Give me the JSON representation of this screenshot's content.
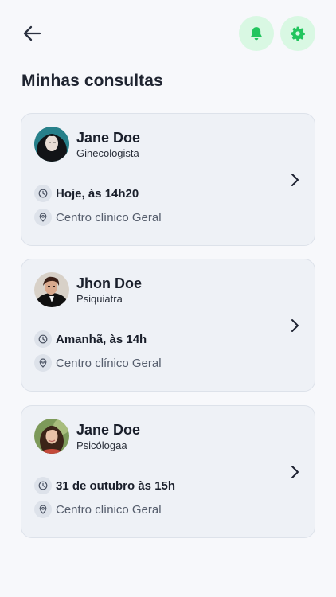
{
  "header": {
    "back_icon": "arrow-left-icon",
    "notifications_icon": "bell-icon",
    "settings_icon": "gear-icon",
    "accent_color": "#22c55e",
    "accent_bg": "#d9f8e3"
  },
  "page": {
    "title": "Minhas consultas"
  },
  "appointments": [
    {
      "doctor": "Jane Doe",
      "specialty": "Ginecologista",
      "when": "Hoje, às 14h20",
      "place": "Centro clínico Geral"
    },
    {
      "doctor": "Jhon Doe",
      "specialty": "Psiquiatra",
      "when": "Amanhã, às 14h",
      "place": "Centro clínico Geral"
    },
    {
      "doctor": "Jane Doe",
      "specialty": "Psicólogaa",
      "when": "31 de outubro às 15h",
      "place": "Centro clínico Geral"
    }
  ]
}
